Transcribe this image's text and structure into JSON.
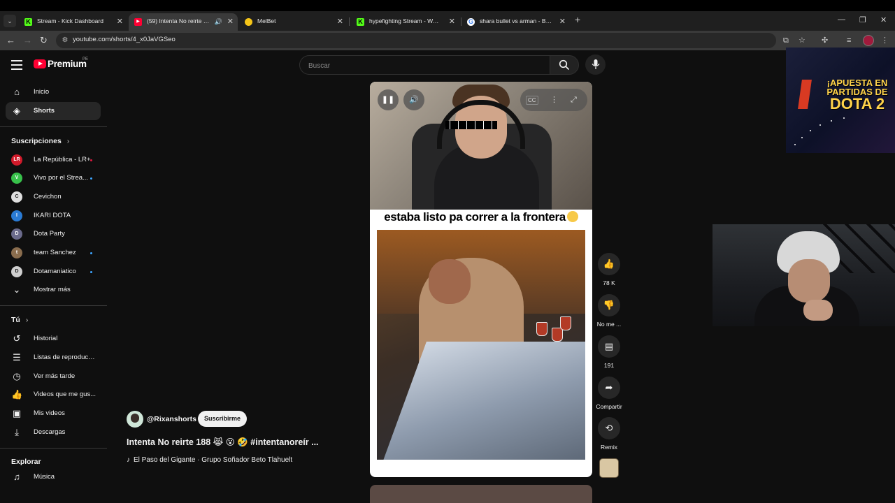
{
  "browser": {
    "tabs": [
      {
        "title": "Stream - Kick Dashboard",
        "favicon": "kick-icon",
        "color": "#53fc18",
        "active": false
      },
      {
        "title": "(59) Intenta No reirte 188😹",
        "favicon": "youtube-icon",
        "color": "#ff0033",
        "active": true
      },
      {
        "title": "MelBet",
        "favicon": "melbet-icon",
        "color": "#f5c518",
        "active": false
      },
      {
        "title": "hypefighting Stream - Watch Li",
        "favicon": "kick-icon",
        "color": "#53fc18",
        "active": false
      },
      {
        "title": "shara bullet vs arman - Buscar c",
        "favicon": "google-icon",
        "color": "#ffffff",
        "active": false
      }
    ],
    "url": "youtube.com/shorts/4_x0JaVGSeo"
  },
  "youtube": {
    "logo_text": "Premium",
    "logo_region": "PE",
    "search_placeholder": "Buscar",
    "nav": [
      {
        "label": "Inicio",
        "icon": "home-icon"
      },
      {
        "label": "Shorts",
        "icon": "shorts-icon",
        "active": true
      }
    ],
    "subscriptions_title": "Suscripciones",
    "subscriptions": [
      {
        "label": "La República - LR+",
        "avatar_text": "LR",
        "avatar_color": "#d11a2a",
        "live": true
      },
      {
        "label": "Vivo por el Strea...",
        "avatar_text": "V",
        "avatar_color": "#38c24b",
        "live": true
      },
      {
        "label": "Cevichon",
        "avatar_text": "C",
        "avatar_color": "#e0e0e0",
        "live": false
      },
      {
        "label": "IKARI DOTA",
        "avatar_text": "I",
        "avatar_color": "#2a7bd5",
        "live": false
      },
      {
        "label": "Dota Party",
        "avatar_text": "D",
        "avatar_color": "#6b6b8c",
        "live": false
      },
      {
        "label": "team Sanchez",
        "avatar_text": "t",
        "avatar_color": "#8a6d4e",
        "live": true
      },
      {
        "label": "Dotamaniatico",
        "avatar_text": "D",
        "avatar_color": "#cfcfcf",
        "live": true
      }
    ],
    "show_more_label": "Mostrar más",
    "you_title": "Tú",
    "you_items": [
      {
        "label": "Historial",
        "icon": "history-icon"
      },
      {
        "label": "Listas de reproducc...",
        "icon": "playlist-icon"
      },
      {
        "label": "Ver más tarde",
        "icon": "clock-icon"
      },
      {
        "label": "Videos que me gus...",
        "icon": "thumbs-up-icon"
      },
      {
        "label": "Mis videos",
        "icon": "my-videos-icon"
      },
      {
        "label": "Descargas",
        "icon": "download-icon"
      }
    ],
    "explore_title": "Explorar",
    "explore_items": [
      {
        "label": "Música",
        "icon": "music-icon"
      }
    ]
  },
  "short": {
    "caption": "estaba listo pa correr a la frontera",
    "channel": "@Rixanshorts",
    "subscribe_label": "Suscribirme",
    "title": "Intenta No reirte 188 😹 😮 🤣 #intentanoreír ...",
    "music": "El Paso del Gigante · Grupo Soñador Beto Tlahuelt",
    "actions": [
      {
        "icon": "thumbs-up-icon",
        "label": "78 K"
      },
      {
        "icon": "thumbs-down-icon",
        "label": "No me ..."
      },
      {
        "icon": "comment-icon",
        "label": "191"
      },
      {
        "icon": "share-icon",
        "label": "Compartir"
      },
      {
        "icon": "remix-icon",
        "label": "Remix"
      }
    ]
  },
  "overlay": {
    "promo_lines": [
      "¡APUESTA EN",
      "PARTIDAS DE",
      "DOTA 2"
    ]
  }
}
